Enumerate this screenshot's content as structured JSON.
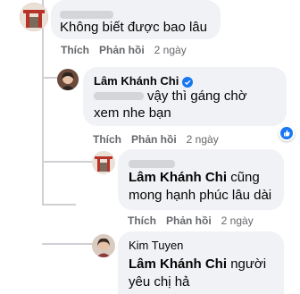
{
  "comments": [
    {
      "text": "Không biết được bao lâu",
      "actions": {
        "like": "Thích",
        "reply": "Phản hồi",
        "time": "2 ngày"
      }
    },
    {
      "author": "Lâm Khánh Chi",
      "text_line1": "vậy thì gáng chờ",
      "text_line2": "xem nhe bạn",
      "actions": {
        "like": "Thích",
        "reply": "Phản hồi",
        "time": "2 ngày"
      }
    },
    {
      "mention": "Lâm Khánh Chi",
      "text_line1": "cũng",
      "text_line2": "mong hạnh phúc lâu dài",
      "actions": {
        "like": "Thích",
        "reply": "Phản hồi",
        "time": "2 ngày"
      }
    },
    {
      "author": "Kim Tuyen",
      "mention": "Lâm Khánh Chi",
      "text_line1": "người",
      "text_line2": "yêu chị hả"
    }
  ],
  "colors": {
    "bubble": "#f0f2f5",
    "meta_text": "#65676b",
    "verified": "#1877f2",
    "reaction_bg": "#1877f2",
    "thread_line": "#ced0d4"
  },
  "icons": {
    "verified": "verified-badge-icon",
    "reaction": "thumbs-up-icon"
  }
}
